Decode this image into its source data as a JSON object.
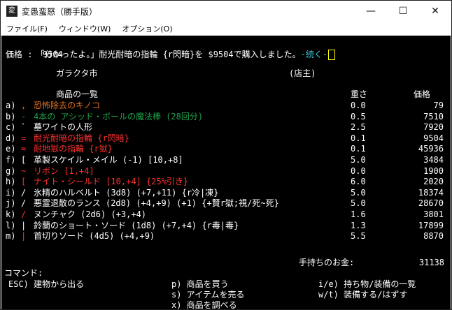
{
  "window": {
    "title": "変愚蛮怒（勝手版）",
    "controls": {
      "minimize": "—",
      "maximize": "☐",
      "close": "✕"
    }
  },
  "menu": [
    "ファイル(F)",
    "ウィンドウ(W)",
    "オプション(O)"
  ],
  "terminal": {
    "message_main": "「分かったよ。」耐光耐暗の指輪 {r閃暗}を $9504で購入しました。",
    "message_more": "-続く-",
    "price_line": "価格 :  9504",
    "store_name": "ガラクタ市",
    "owner": "(店主)",
    "headers": {
      "list": "商品の一覧",
      "weight": "重さ",
      "price": "価格"
    },
    "items": [
      {
        "label": "a)",
        "sym": ",",
        "name": "恐怖除去のキノコ",
        "weight": "0.0",
        "price": "79",
        "sym_color": "#e07020",
        "name_color": "#e07020"
      },
      {
        "label": "b)",
        "sym": "-",
        "name": "4本の アシッド・ボールの魔法棒 (28回分)",
        "weight": "0.5",
        "price": "7510",
        "sym_color": "#1fa04a",
        "name_color": "#1fa04a"
      },
      {
        "label": "c)",
        "sym": "`",
        "name": "墓ワイトの人形",
        "weight": "2.5",
        "price": "7920",
        "sym_color": "#ffffff",
        "name_color": "#ffffff"
      },
      {
        "label": "d)",
        "sym": "=",
        "name": "耐光耐暗の指輪 {r閃暗}",
        "weight": "0.1",
        "price": "9504",
        "sym_color": "#ff3030",
        "name_color": "#ff3030"
      },
      {
        "label": "e)",
        "sym": "=",
        "name": "耐地獄の指輪 {r獄}",
        "weight": "0.1",
        "price": "45936",
        "sym_color": "#ff3030",
        "name_color": "#ff3030"
      },
      {
        "label": "f)",
        "sym": "[",
        "name": "革製スケイル・メイル (-1) [10,+8]",
        "weight": "5.0",
        "price": "3484",
        "sym_color": "#ffffff",
        "name_color": "#ffffff"
      },
      {
        "label": "g)",
        "sym": "~",
        "name": "リボン [1,+4]",
        "weight": "0.0",
        "price": "1900",
        "sym_color": "#ff3030",
        "name_color": "#ff3030"
      },
      {
        "label": "h)",
        "sym": "[",
        "name": "ナイト・シールド [10,+4] {25%引き}",
        "weight": "6.0",
        "price": "2020",
        "sym_color": "#ff3030",
        "name_color": "#ff3030"
      },
      {
        "label": "i)",
        "sym": "/",
        "name": "氷精のハルベルト (3d8) (+7,+11) {r冷|凍}",
        "weight": "5.0",
        "price": "18374",
        "sym_color": "#ffffff",
        "name_color": "#ffffff"
      },
      {
        "label": "j)",
        "sym": "/",
        "name": "悪霊退散のランス (2d8) (+4,+9) (+1) {+賢r獄;視/死~死}",
        "weight": "5.0",
        "price": "28670",
        "sym_color": "#ffffff",
        "name_color": "#ffffff"
      },
      {
        "label": "k)",
        "sym": "/",
        "name": "ヌンチャク (2d6) (+3,+4)",
        "weight": "1.6",
        "price": "3801",
        "sym_color": "#ff3030",
        "name_color": "#ffffff"
      },
      {
        "label": "l)",
        "sym": "|",
        "name": "鈴蘭のショート・ソード (1d8) (+7,+4) {r毒|毒}",
        "weight": "1.3",
        "price": "17899",
        "sym_color": "#ffffff",
        "name_color": "#ffffff"
      },
      {
        "label": "m)",
        "sym": "|",
        "name": "首切りソード (4d5) (+4,+9)",
        "weight": "5.5",
        "price": "8870",
        "sym_color": "#ff3030",
        "name_color": "#ffffff"
      }
    ],
    "gold_label": "手持ちのお金:",
    "gold_value": "31138",
    "command_label": "コマンド:",
    "commands": {
      "esc": "ESC) 建物から出る",
      "p": "p) 商品を買う",
      "s": "s) アイテムを売る",
      "x": "x) 商品を調べる",
      "ie": "i/e) 持ち物/装備の一覧",
      "wt": "w/t) 装備する/はずす"
    },
    "colors": {
      "message_more": "#38c8d8",
      "cursor": "#ffff00"
    }
  }
}
